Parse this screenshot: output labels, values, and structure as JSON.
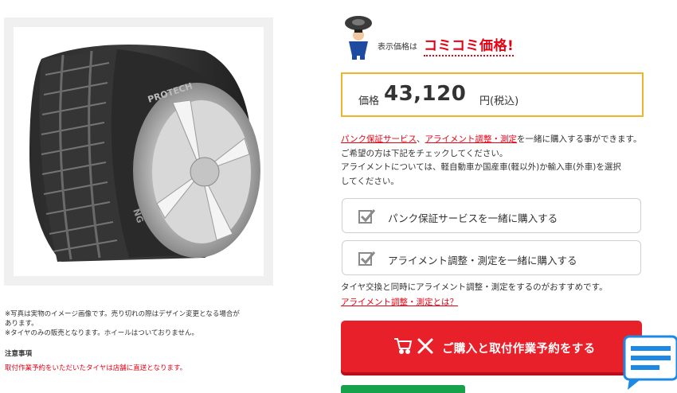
{
  "product_image": {
    "brand_text": "PROTECH",
    "side_text": "NG"
  },
  "notes": {
    "line1": "※写真は実物のイメージ画像です。売り切れの際はデザイン変更となる場合が",
    "line2": "あります。",
    "line3": "※タイヤのみの販売となります。ホイールはついておりません。",
    "heading": "注意事項",
    "warning": "取付作業予約をいただいたタイヤは店舗に直送となります。"
  },
  "banner": {
    "label": "表示価格は",
    "strong": "コミコミ価格!"
  },
  "price": {
    "label": "価格",
    "amount": "43,120",
    "unit": "円(税込)"
  },
  "description": {
    "link1": "パンク保証サービス",
    "sep": "、",
    "link2": "アライメント調整・測定",
    "line1_rest": "を一緒に購入する事ができます。",
    "line2": "ご希望の方は下記をチェックしてください。",
    "line3": "アライメントについては、軽自動車か国産車(軽以外)か輸入車(外車)を選択",
    "line4": "してください。"
  },
  "options": {
    "puncture": "パンク保証サービスを一緒に購入する",
    "alignment": "アライメント調整・測定を一緒に購入する"
  },
  "recommendation": "タイヤ交換と同時にアライメント調整・測定をするのがおすすめです。",
  "alignment_link": "アライメント調整・測定とは？",
  "buy_button": "ご購入と取付作業予約をする",
  "colors": {
    "accent_red": "#e60012",
    "button_red": "#e8202a",
    "price_border": "#f0b429",
    "green": "#15a24a",
    "chat_blue": "#1e88e5"
  },
  "icons": [
    "mascot-icon",
    "checkbox-icon",
    "cart-icon",
    "tools-icon",
    "chat-icon"
  ]
}
